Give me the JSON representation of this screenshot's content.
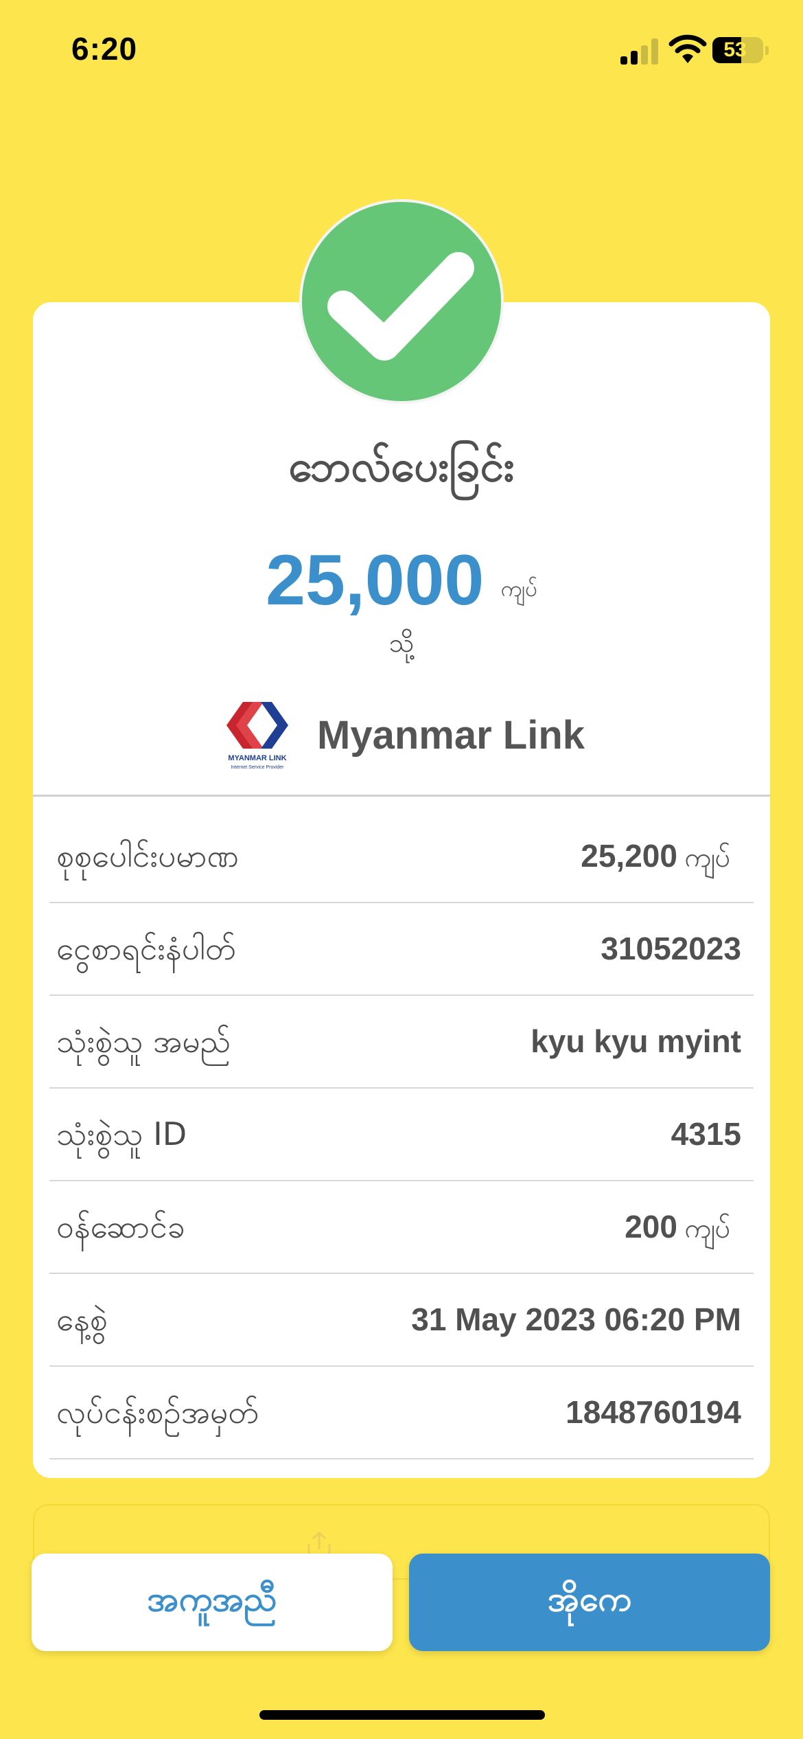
{
  "status_bar": {
    "time": "6:20",
    "battery": "53",
    "icons": [
      "signal-icon",
      "wifi-icon",
      "battery-icon"
    ]
  },
  "receipt": {
    "title": "ဘေလ်ပေးခြင်း",
    "amount": "25,000",
    "amount_unit": "ကျပ်",
    "to_label": "သို့",
    "merchant": {
      "name": "Myanmar Link",
      "logo_text": "MYANMAR LINK",
      "logo_subtext": "Internet Service Provider"
    },
    "rows": [
      {
        "label": "စုစုပေါင်းပမာဏ",
        "value": "25,200",
        "unit": "ကျပ်"
      },
      {
        "label": "ငွေစာရင်းနံပါတ်",
        "value": "31052023"
      },
      {
        "label": "သုံးစွဲသူ အမည်",
        "value": "kyu kyu myint"
      },
      {
        "label": "သုံးစွဲသူ ID",
        "value": "4315"
      },
      {
        "label": "ဝန်ဆောင်ခ",
        "value": "200",
        "unit": "ကျပ်"
      },
      {
        "label": "နေ့စွဲ",
        "value": "31 May 2023 06:20 PM"
      },
      {
        "label": "လုပ်ငန်းစဉ်အမှတ်",
        "value": "1848760194"
      }
    ]
  },
  "buttons": {
    "help_label": "အကူအညီ",
    "ok_label": "အိုကေ"
  },
  "colors": {
    "background": "#FCE54D",
    "accent": "#3B8FCB",
    "success": "#66C677"
  }
}
